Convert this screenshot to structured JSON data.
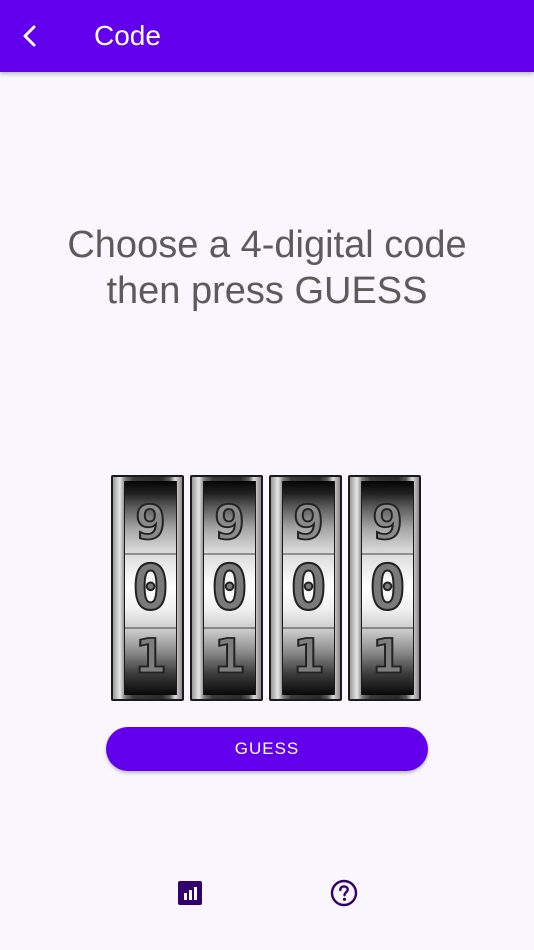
{
  "appbar": {
    "title": "Code",
    "back_icon": "chevron-left-icon",
    "background": "#6200ee"
  },
  "instruction": {
    "line1": "Choose a 4-digital code",
    "line2": "then press GUESS"
  },
  "wheels": [
    {
      "above": "9",
      "current": "0",
      "below": "1"
    },
    {
      "above": "9",
      "current": "0",
      "below": "1"
    },
    {
      "above": "9",
      "current": "0",
      "below": "1"
    },
    {
      "above": "9",
      "current": "0",
      "below": "1"
    }
  ],
  "guess_button": {
    "label": "GUESS",
    "color": "#6200ee"
  },
  "bottom_icons": {
    "stats_icon": "bar-chart-icon",
    "help_icon": "help-circle-icon"
  }
}
